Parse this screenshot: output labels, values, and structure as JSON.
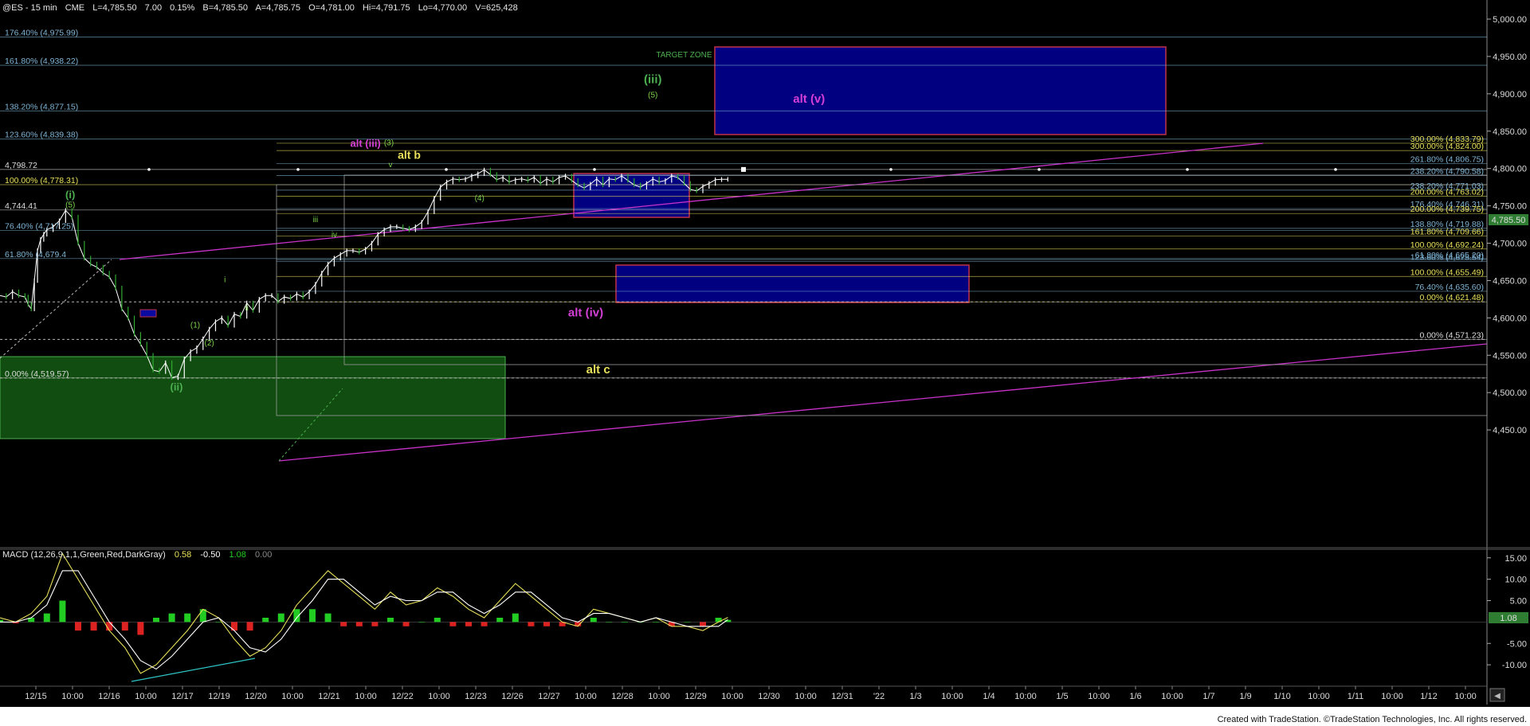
{
  "header": {
    "symbol": "@ES - 15 min",
    "exchange": "CME",
    "last": "L=4,785.50",
    "change": "7.00",
    "change_pct": "0.15%",
    "bid": "B=4,785.50",
    "ask": "A=4,785.75",
    "open": "O=4,781.00",
    "high": "Hi=4,791.75",
    "low": "Lo=4,770.00",
    "volume": "V=625,428"
  },
  "footer": {
    "credit": "Created with TradeStation. ©TradeStation Technologies, Inc. All rights reserved."
  },
  "chart_data": [
    {
      "type": "line",
      "name": "price",
      "ylim": [
        4400,
        5000
      ],
      "xlabel": "",
      "ylabel": "",
      "x_ticks": [
        "12/15",
        "10:00",
        "12/16",
        "10:00",
        "12/17",
        "12/19",
        "12/20",
        "10:00",
        "12/21",
        "10:00",
        "12/22",
        "10:00",
        "12/23",
        "12/26",
        "12/27",
        "10:00",
        "12/28",
        "10:00",
        "12/29",
        "10:00",
        "12/30",
        "10:00",
        "12/31",
        "'22",
        "1/3",
        "10:00",
        "1/4",
        "10:00",
        "1/5",
        "10:00",
        "1/6",
        "10:00",
        "1/7",
        "1/9",
        "1/10",
        "10:00",
        "1/11",
        "10:00",
        "1/12",
        "10:00"
      ],
      "y_ticks": [
        "5,000.00",
        "4,950.00",
        "4,900.00",
        "4,850.00",
        "4,800.00",
        "4,750.00",
        "4,700.00",
        "4,650.00",
        "4,600.00",
        "4,550.00",
        "4,500.00",
        "4,450.00"
      ],
      "y_values": [
        5000,
        4950,
        4900,
        4850,
        4800,
        4750,
        4700,
        4650,
        4600,
        4550,
        4500,
        4450
      ],
      "last_value_label": "4,785.50",
      "grid": false,
      "series": [
        {
          "x": [
            0,
            4,
            8,
            12,
            16,
            18,
            20,
            22,
            24,
            26,
            28,
            30,
            34,
            38,
            42,
            46,
            50,
            54,
            58,
            62,
            66,
            70,
            74,
            78,
            82,
            86,
            90,
            94,
            98,
            102,
            106,
            110,
            114,
            118,
            122,
            126,
            130,
            134,
            138,
            142,
            146,
            150,
            154,
            158,
            162,
            166,
            170,
            174,
            178,
            182,
            186,
            190,
            194,
            198,
            202,
            206,
            210,
            214,
            218,
            222,
            226,
            230,
            234,
            238,
            242,
            246,
            250,
            254,
            258,
            262,
            266,
            270,
            274,
            278,
            282,
            286,
            290,
            294,
            298,
            302,
            306,
            310,
            314,
            318,
            322,
            326,
            330,
            334,
            338,
            342,
            346,
            350,
            354,
            358,
            362,
            366,
            370,
            374,
            378,
            382,
            386,
            390,
            394,
            398,
            402,
            406,
            410,
            414,
            418,
            422,
            426,
            430,
            434,
            438,
            442,
            446,
            450,
            454,
            458,
            462,
            466
          ],
          "y": [
            4630,
            4628,
            4635,
            4630,
            4628,
            4618,
            4612,
            4650,
            4690,
            4705,
            4712,
            4718,
            4722,
            4730,
            4744,
            4735,
            4700,
            4680,
            4672,
            4668,
            4660,
            4655,
            4640,
            4612,
            4600,
            4578,
            4565,
            4550,
            4530,
            4528,
            4540,
            4520,
            4522,
            4545,
            4555,
            4560,
            4572,
            4585,
            4595,
            4600,
            4590,
            4605,
            4602,
            4620,
            4610,
            4625,
            4630,
            4630,
            4622,
            4628,
            4626,
            4632,
            4628,
            4635,
            4645,
            4660,
            4672,
            4680,
            4685,
            4690,
            4690,
            4688,
            4692,
            4700,
            4712,
            4718,
            4722,
            4722,
            4720,
            4718,
            4722,
            4728,
            4742,
            4760,
            4775,
            4782,
            4786,
            4785,
            4786,
            4790,
            4793,
            4798,
            4792,
            4785,
            4788,
            4782,
            4785,
            4786,
            4784,
            4788,
            4780,
            4786,
            4782,
            4788,
            4790,
            4784,
            4778,
            4774,
            4779,
            4786,
            4778,
            4786,
            4785,
            4790,
            4784,
            4778,
            4775,
            4780,
            4786,
            4782,
            4784,
            4790,
            4788,
            4780,
            4772,
            4770,
            4776,
            4780,
            4785,
            4785.5,
            4785.5
          ]
        }
      ]
    },
    {
      "type": "line",
      "name": "MACD (12,26,9,1,1,Green,Red,DarkGray)",
      "legend_values": [
        "0.58",
        "-0.50",
        "1.08",
        "0.00"
      ],
      "ylim": [
        -15,
        17
      ],
      "y_ticks": [
        "15.00",
        "10.00",
        "5.00",
        "-5.00",
        "-10.00"
      ],
      "y_values": [
        15,
        10,
        5,
        -5,
        -10
      ],
      "last_value_label": "1.08",
      "series": [
        {
          "name": "MACD",
          "x": [
            0,
            10,
            20,
            30,
            40,
            50,
            60,
            70,
            80,
            90,
            100,
            110,
            120,
            130,
            140,
            150,
            160,
            170,
            180,
            190,
            200,
            210,
            220,
            230,
            240,
            250,
            260,
            270,
            280,
            290,
            300,
            310,
            320,
            330,
            340,
            350,
            360,
            370,
            380,
            390,
            400,
            410,
            420,
            430,
            440,
            450,
            460,
            466
          ],
          "y": [
            1,
            0,
            2,
            6,
            16,
            10,
            4,
            -2,
            -6,
            -12,
            -10,
            -6,
            -2,
            3,
            1,
            -4,
            -8,
            -6,
            -2,
            4,
            8,
            12,
            9,
            6,
            3,
            7,
            4,
            5,
            8,
            6,
            3,
            1,
            5,
            9,
            6,
            3,
            0,
            -1,
            3,
            2,
            1,
            0,
            1,
            -1,
            -1,
            -2,
            0,
            1.08
          ]
        },
        {
          "name": "Signal",
          "x": [
            0,
            10,
            20,
            30,
            40,
            50,
            60,
            70,
            80,
            90,
            100,
            110,
            120,
            130,
            140,
            150,
            160,
            170,
            180,
            190,
            200,
            210,
            220,
            230,
            240,
            250,
            260,
            270,
            280,
            290,
            300,
            310,
            320,
            330,
            340,
            350,
            360,
            370,
            380,
            390,
            400,
            410,
            420,
            430,
            440,
            450,
            460,
            466
          ],
          "y": [
            0,
            0,
            1,
            4,
            12,
            12,
            6,
            0,
            -4,
            -9,
            -11,
            -8,
            -4,
            0,
            1,
            -2,
            -6,
            -7,
            -4,
            1,
            5,
            10,
            10,
            7,
            4,
            6,
            5,
            5,
            7,
            7,
            4,
            2,
            4,
            7,
            7,
            4,
            1,
            0,
            2,
            2,
            1,
            0,
            1,
            0,
            -1,
            -1,
            -1,
            0.58
          ]
        }
      ],
      "histogram": [
        0.5,
        -0.3,
        1,
        2,
        5,
        -2,
        -2,
        -2,
        -2,
        -3,
        1,
        2,
        2,
        3,
        0,
        -2,
        -2,
        1,
        2,
        3,
        3,
        2,
        -1,
        -1,
        -1,
        1,
        -1,
        0,
        1,
        -1,
        -1,
        -1,
        1,
        2,
        -1,
        -1,
        -1,
        -1,
        1,
        0,
        0,
        0,
        0,
        -1,
        0,
        -1,
        1,
        0.5
      ]
    }
  ],
  "fib_labels": [
    {
      "text": "176.40% (4,975.99)",
      "value": 4975.99,
      "color": "#7fb5d6",
      "side": "left"
    },
    {
      "text": "161.80% (4,938.22)",
      "value": 4938.22,
      "color": "#7fb5d6",
      "side": "left"
    },
    {
      "text": "138.20% (4,877.15)",
      "value": 4877.15,
      "color": "#7fb5d6",
      "side": "left"
    },
    {
      "text": "123.60% (4,839.38)",
      "value": 4839.38,
      "color": "#7fb5d6",
      "side": "left"
    },
    {
      "text": "4,798.72",
      "value": 4798.72,
      "color": "#dddddd",
      "side": "left"
    },
    {
      "text": "100.00% (4,778.31)",
      "value": 4778.31,
      "color": "#e8e05a",
      "side": "left"
    },
    {
      "text": "4,744.41",
      "value": 4744.41,
      "color": "#dddddd",
      "side": "left"
    },
    {
      "text": "76.40% (4,717.25)",
      "value": 4717.25,
      "color": "#7fb5d6",
      "side": "left"
    },
    {
      "text": "61.80% (4,679.4",
      "value": 4679.4,
      "color": "#7fb5d6",
      "side": "left"
    },
    {
      "text": "0.00% (4,519.57)",
      "value": 4519.57,
      "color": "#dddddd",
      "side": "left"
    },
    {
      "text": "300.00% (4,833.79)",
      "value": 4833.79,
      "color": "#e8e05a",
      "side": "right"
    },
    {
      "text": "300.00% (4,824.00)",
      "value": 4824.0,
      "color": "#e8e05a",
      "side": "right"
    },
    {
      "text": "261.80% (4,806.75)",
      "value": 4806.75,
      "color": "#7fb5d6",
      "side": "right"
    },
    {
      "text": "238.20% (4,790.58)",
      "value": 4790.58,
      "color": "#7fb5d6",
      "side": "right"
    },
    {
      "text": "238.20% (4,771.03)",
      "value": 4771.03,
      "color": "#7fb5d6",
      "side": "right"
    },
    {
      "text": "200.00% (4,763.02)",
      "value": 4763.02,
      "color": "#e8e05a",
      "side": "right"
    },
    {
      "text": "176.40% (4,746.31)",
      "value": 4746.31,
      "color": "#7fb5d6",
      "side": "right"
    },
    {
      "text": "200.00% (4,739.75)",
      "value": 4739.75,
      "color": "#e8e05a",
      "side": "right"
    },
    {
      "text": "138.80% (4,719.88)",
      "value": 4719.88,
      "color": "#7fb5d6",
      "side": "right"
    },
    {
      "text": "161.80% (4,709.66)",
      "value": 4709.66,
      "color": "#e8e05a",
      "side": "right"
    },
    {
      "text": "100.00% (4,692.24)",
      "value": 4692.24,
      "color": "#e8e05a",
      "side": "right"
    },
    {
      "text": "61.80% (4,665.20)",
      "value": 4678.0,
      "color": "#7fb5d6",
      "side": "right"
    },
    {
      "text": "123.60% (4,675.54)",
      "value": 4675.54,
      "color": "#7fb5d6",
      "side": "right"
    },
    {
      "text": "100.00% (4,655.49)",
      "value": 4655.49,
      "color": "#e8e05a",
      "side": "right"
    },
    {
      "text": "76.40% (4,635.60)",
      "value": 4635.6,
      "color": "#7fb5d6",
      "side": "right"
    },
    {
      "text": "0.00% (4,621.48)",
      "value": 4621.48,
      "color": "#e8e05a",
      "side": "right"
    },
    {
      "text": "0.00% (4,571.23)",
      "value": 4571.23,
      "color": "#dddddd",
      "side": "right"
    }
  ],
  "wave_labels": [
    {
      "text": "(i)",
      "x": 45,
      "value": 4760,
      "color": "#4caf50",
      "size": 13
    },
    {
      "text": "(5)",
      "x": 45,
      "value": 4748,
      "color": "#7bd24a",
      "size": 10
    },
    {
      "text": "(ii)",
      "x": 113,
      "value": 4503,
      "color": "#4caf50",
      "size": 13
    },
    {
      "text": "(1)",
      "x": 125,
      "value": 4587,
      "color": "#7bd24a",
      "size": 10
    },
    {
      "text": "(2)",
      "x": 134,
      "value": 4563,
      "color": "#7bd24a",
      "size": 10
    },
    {
      "text": "i",
      "x": 144,
      "value": 4648,
      "color": "#7bd24a",
      "size": 10
    },
    {
      "text": "ii",
      "x": 158,
      "value": 4610,
      "color": "#7bd24a",
      "size": 10
    },
    {
      "text": "iii",
      "x": 202,
      "value": 4728,
      "color": "#7bd24a",
      "size": 10
    },
    {
      "text": "iv",
      "x": 214,
      "value": 4708,
      "color": "#7bd24a",
      "size": 10
    },
    {
      "text": "v",
      "x": 250,
      "value": 4802,
      "color": "#7bd24a",
      "size": 10
    },
    {
      "text": "(3)",
      "x": 249,
      "value": 4831,
      "color": "#7bd24a",
      "size": 10
    },
    {
      "text": "alt (iii)",
      "x": 234,
      "value": 4829,
      "color": "#d43fd6",
      "size": 13
    },
    {
      "text": "alt b",
      "x": 262,
      "value": 4813,
      "color": "#e8e05a",
      "size": 14
    },
    {
      "text": "(4)",
      "x": 307,
      "value": 4757,
      "color": "#7bd24a",
      "size": 10
    },
    {
      "text": "TARGET ZONE",
      "x": 438,
      "value": 4949,
      "color": "#4caf50",
      "size": 10
    },
    {
      "text": "(iii)",
      "x": 418,
      "value": 4914,
      "color": "#4caf50",
      "size": 15
    },
    {
      "text": "(5)",
      "x": 418,
      "value": 4895,
      "color": "#7bd24a",
      "size": 10
    },
    {
      "text": "alt (v)",
      "x": 518,
      "value": 4888,
      "color": "#d43fd6",
      "size": 15
    },
    {
      "text": "alt (iv)",
      "x": 375,
      "value": 4602,
      "color": "#d43fd6",
      "size": 15
    },
    {
      "text": "alt c",
      "x": 383,
      "value": 4526,
      "color": "#e8e05a",
      "size": 15
    }
  ],
  "colors": {
    "background": "#000000",
    "price_up": "#ffffff",
    "price_down": "#2ea82e",
    "macd_line": "#e8e05a",
    "signal_line": "#ffffff",
    "hist_pos": "#22cc22",
    "hist_neg": "#dd2222",
    "last_price_tag": "#2e7d32"
  }
}
